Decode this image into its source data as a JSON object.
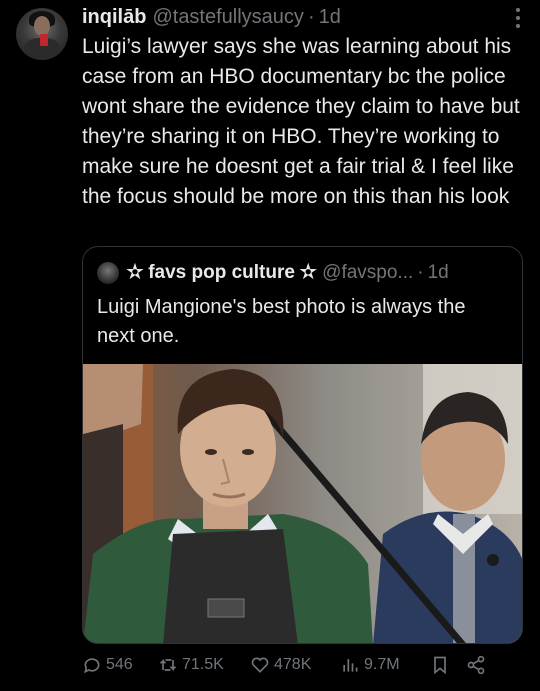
{
  "author": {
    "name": "inqilāb",
    "handle": "@tastefullysaucy",
    "time": "1d"
  },
  "tweet": {
    "text": "Luigi’s lawyer says she was learning about his case from an HBO documentary bc the police wont share the evidence they claim to have but they’re sharing it on HBO. They’re working to make sure he doesnt get a fair trial & I feel like the focus should be more on this than his look"
  },
  "quote": {
    "name": "✫ favs pop culture ✫",
    "handle": "@favspo...",
    "time": "1d",
    "text": "Luigi Mangione's best photo is always the next one."
  },
  "actions": {
    "replies": "546",
    "reposts": "71.5K",
    "likes": "478K",
    "views": "9.7M"
  }
}
